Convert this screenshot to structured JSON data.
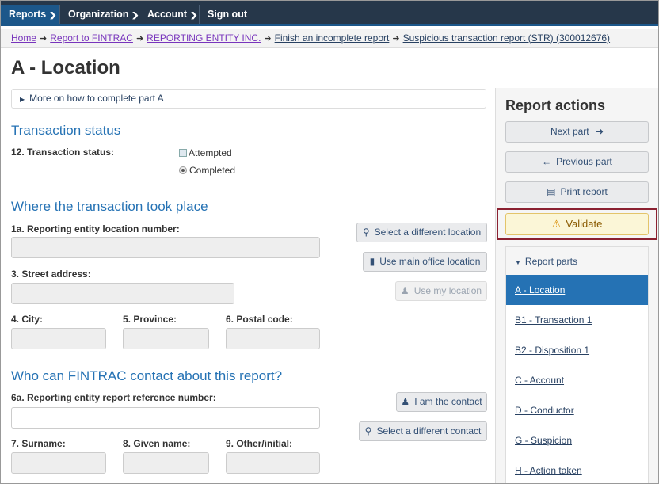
{
  "nav": {
    "reports": "Reports",
    "organization": "Organization",
    "account": "Account",
    "signout": "Sign out"
  },
  "breadcrumb": {
    "home": "Home",
    "report_to_fintrac": "Report to FINTRAC",
    "entity": "REPORTING ENTITY INC.",
    "finish": "Finish an incomplete report",
    "str": "Suspicious transaction report (STR) (300012676)"
  },
  "page_title": "A - Location",
  "details_link": "More on how to complete part A",
  "transaction_status": {
    "heading": "Transaction status",
    "label": "12. Transaction status:",
    "option_attempted": "Attempted",
    "option_completed": "Completed"
  },
  "location": {
    "heading": "Where the transaction took place",
    "location_number_label": "1a. Reporting entity location number:",
    "street_label": "3. Street address:",
    "city_label": "4. City:",
    "province_label": "5. Province:",
    "postal_label": "6. Postal code:",
    "select_location_btn": "Select a different location",
    "main_office_btn": "Use main office location",
    "my_location_btn": "Use my location"
  },
  "contact": {
    "heading": "Who can FINTRAC contact about this report?",
    "reference_label": "6a. Reporting entity report reference number:",
    "surname_label": "7. Surname:",
    "given_label": "8. Given name:",
    "other_label": "9. Other/initial:",
    "i_am_contact_btn": "I am the contact",
    "select_contact_btn": "Select a different contact"
  },
  "report_actions": {
    "heading": "Report actions",
    "next": "Next part",
    "previous": "Previous part",
    "print": "Print report",
    "validate": "Validate",
    "parts_heading": "Report parts",
    "parts": [
      "A - Location",
      "B1 - Transaction 1",
      "B2 - Disposition 1",
      "C - Account",
      "D - Conductor",
      "G - Suspicion",
      "H - Action taken"
    ]
  },
  "colors": {
    "nav_bg": "#26374a",
    "heading_blue": "#2572b4",
    "active_part": "#2572b4",
    "validate_border": "#8b2131",
    "validate_bg": "#fbf6d7"
  }
}
